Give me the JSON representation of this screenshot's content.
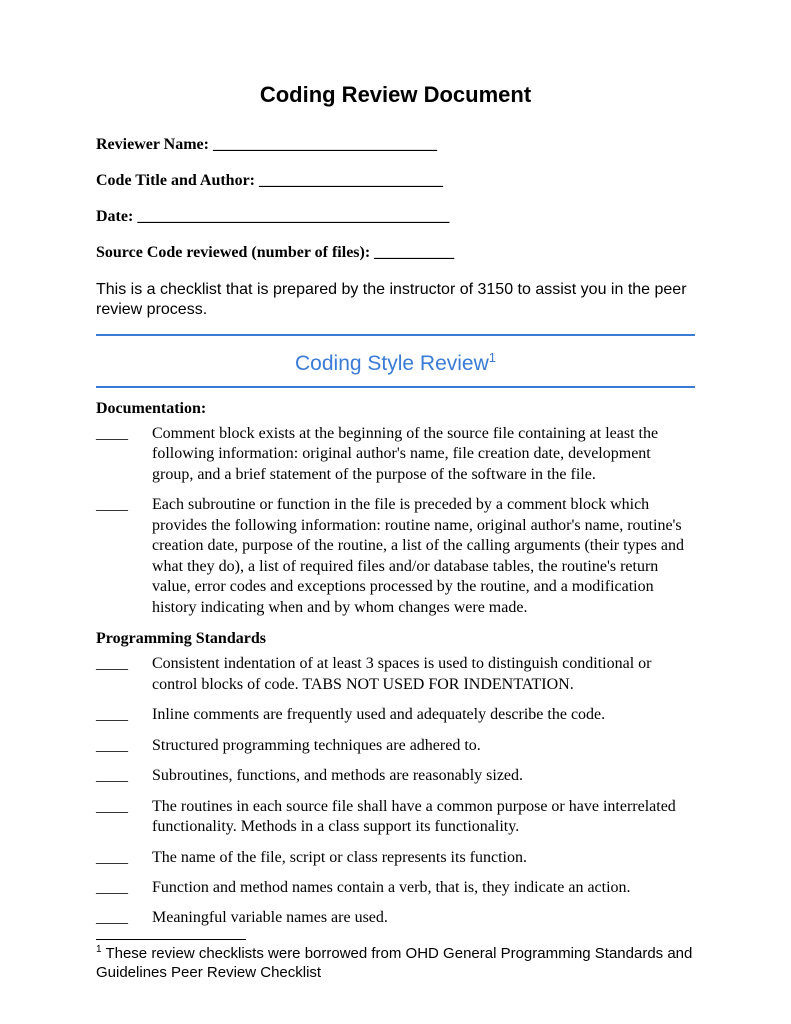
{
  "title": "Coding Review Document",
  "fields": {
    "reviewer": "Reviewer Name: ____________________________",
    "codeTitle": "Code Title and Author: _______________________",
    "date": "Date: _______________________________________",
    "source": "Source Code reviewed (number of files): __________"
  },
  "intro": "This is a checklist that is prepared by the instructor of 3150 to assist you in the peer review process.",
  "section": {
    "title": "Coding Style Review",
    "sup": "1"
  },
  "documentation": {
    "heading": "Documentation:",
    "items": [
      "Comment block exists at the beginning of the source file containing at least the following information: original author's name, file creation date, development group, and a brief statement of the purpose of the software in the file.",
      "Each subroutine or function in the file is preceded by a comment block which provides the following information:  routine name, original author's name, routine's creation date,  purpose of the routine,  a list of the calling arguments (their types and what they do),  a list of required files and/or database tables, the routine's return value, error codes and exceptions processed by the routine, and a modification history indicating when and by whom changes were made."
    ]
  },
  "standards": {
    "heading": "Programming Standards",
    "items": [
      "Consistent indentation of at least 3 spaces is used to distinguish conditional or control blocks of code. TABS NOT USED FOR INDENTATION.",
      "Inline comments are frequently used and adequately describe the code.",
      "Structured programming techniques are adhered to.",
      "Subroutines, functions, and methods are reasonably sized.",
      "The routines in each source file shall have a common purpose or have interrelated functionality.  Methods in a class support its functionality.",
      "The name of the file, script or class represents its function.",
      "Function and method names contain a verb, that is, they indicate an action.",
      "Meaningful variable names are used."
    ]
  },
  "blank": "____",
  "footnote": {
    "sup": "1",
    "text": " These review checklists were borrowed from OHD General Programming Standards and Guidelines Peer Review Checklist"
  }
}
